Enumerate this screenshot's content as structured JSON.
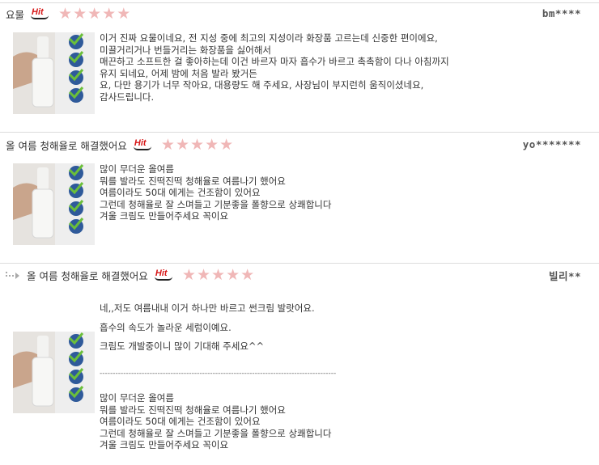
{
  "reviews": [
    {
      "title": "요물",
      "badge": "Hit",
      "rating": 5,
      "author": "bm****",
      "lines": [
        "이거 진짜 요물이네요, 전 지성 중에 최고의 지성이라 화장품 고르는데 신중한 편이에요,",
        "미끌거리거나 번들거리는 화장품을 싫어해서",
        "매끈하고 소프트한 걸 좋아하는데 이건 바르자 마자 흡수가 바르고 촉촉함이 다나 아침까지",
        "유지 되네요, 어제 밤에 처음 발라 봤거든",
        "요, 다만 용기가 너무 작아요, 대용량도 해 주세요, 사장님이 부지런히 움직이셨네요,",
        "감사드립니다."
      ]
    },
    {
      "title": "올 여름 청해율로 해결했어요",
      "badge": "Hit",
      "rating": 5,
      "author": "yo*******",
      "lines": [
        "많이 무더운 올여름",
        "뭐를 발라도 진떡진떡 청해율로 여름나기 했어요",
        "여름이라도 50대 에게는 건조함이 있어요",
        "그런데 청해율로 잘 스며들고 기분좋을 폴향으로 상쾌합니다",
        "겨울 크림도 만들어주세요 꼭이요"
      ]
    },
    {
      "title": "올 여름 청해율로 해결했어요",
      "badge": "Hit",
      "rating": 5,
      "author": "빌리**",
      "reply_lines": [
        "네,,저도 여름내내 이거 하나만 바르고 썬크림 발랏어요.",
        "흡수의 속도가 놀라운 세럼이예요.",
        "크림도 개발중이니 많이 기대해 주세요^^"
      ],
      "separator": "------------------------------------------------------------------------------------------",
      "lines": [
        "많이 무더운 올여름",
        "뭐를 발라도 진떡진떡 청해율로 여름나기 했어요",
        "여름이라도 50대 에게는 건조함이 있어요",
        "그런데 청해율로 잘 스며들고 기분좋을 폴향으로 상쾌합니다",
        "겨울 크림도 만들어주세요 꼭이요"
      ]
    }
  ],
  "icons": {
    "star": "star-icon",
    "reply": "reply-arrow-icon",
    "thumb": "product-thumbnail"
  },
  "colors": {
    "star": "#f0b7b7",
    "hit": "#d71a1a",
    "divider": "#dcdcdc"
  }
}
